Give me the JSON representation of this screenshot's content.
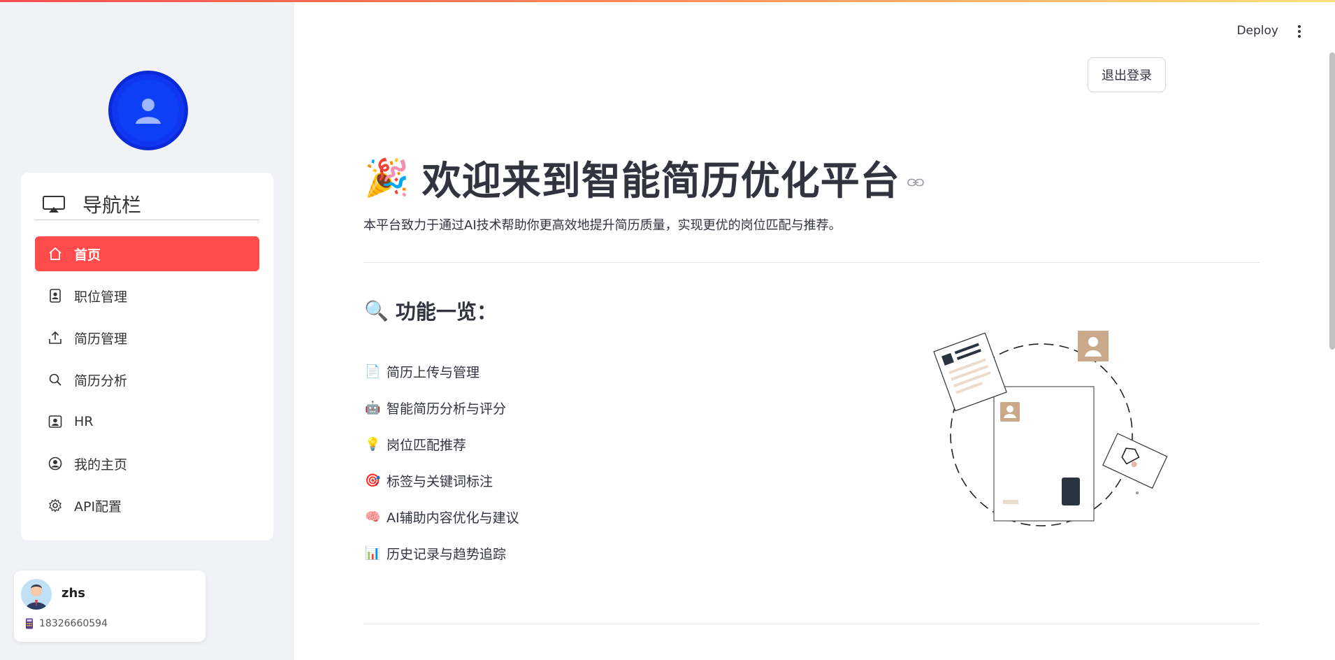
{
  "sidebar": {
    "nav_title": "导航栏",
    "items": [
      {
        "label": "首页",
        "icon": "home-icon",
        "active": true
      },
      {
        "label": "职位管理",
        "icon": "id-badge-icon",
        "active": false
      },
      {
        "label": "简历管理",
        "icon": "upload-icon",
        "active": false
      },
      {
        "label": "简历分析",
        "icon": "search-icon",
        "active": false
      },
      {
        "label": "HR",
        "icon": "person-badge-icon",
        "active": false
      },
      {
        "label": "我的主页",
        "icon": "user-circle-icon",
        "active": false
      },
      {
        "label": "API配置",
        "icon": "gear-icon",
        "active": false
      }
    ],
    "user": {
      "name": "zhs",
      "phone": "18326660594"
    }
  },
  "header": {
    "deploy_label": "Deploy"
  },
  "main": {
    "logout_label": "退出登录",
    "title": "欢迎来到智能简历优化平台",
    "title_emoji": "🎉",
    "intro": "本平台致力于通过AI技术帮助你更高效地提升简历质量，实现更优的岗位匹配与推荐。",
    "features_title": "功能一览：",
    "features_emoji": "🔍",
    "features": [
      {
        "emoji": "📄",
        "label": "简历上传与管理"
      },
      {
        "emoji": "🤖",
        "label": "智能简历分析与评分"
      },
      {
        "emoji": "💡",
        "label": "岗位匹配推荐"
      },
      {
        "emoji": "🎯",
        "label": "标签与关键词标注"
      },
      {
        "emoji": "🧠",
        "label": "AI辅助内容优化与建议"
      },
      {
        "emoji": "📊",
        "label": "历史记录与趋势追踪"
      }
    ]
  },
  "colors": {
    "accent": "#ff4b4b",
    "sidebar_bg": "#f0f2f6",
    "avatar_blue": "#1136f0",
    "illus_tan": "#c9a98a"
  }
}
